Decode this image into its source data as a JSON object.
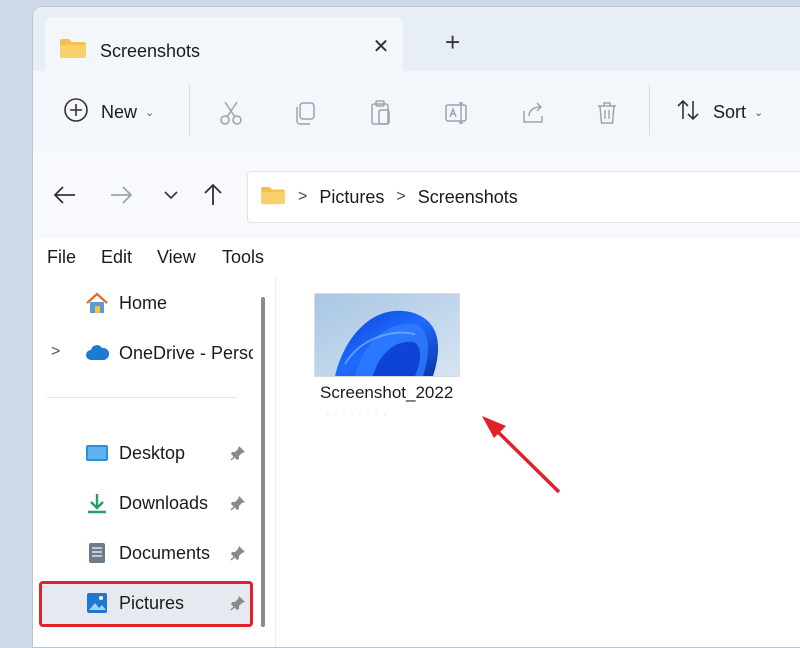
{
  "window": {
    "tab_title": "Screenshots",
    "close_symbol": "✕",
    "new_tab_symbol": "+"
  },
  "toolbar": {
    "new_label": "New",
    "sort_label": "Sort",
    "dropdown_symbol": "⌄",
    "icons": [
      "cut-icon",
      "copy-icon",
      "paste-icon",
      "rename-icon",
      "share-icon",
      "delete-icon"
    ]
  },
  "address": {
    "segments": [
      "Pictures",
      "Screenshots"
    ],
    "separator": ">"
  },
  "menu": {
    "items": [
      "File",
      "Edit",
      "View",
      "Tools"
    ]
  },
  "sidebar": {
    "expand_symbol": ">",
    "items": [
      {
        "label": "Home",
        "icon": "home-icon"
      },
      {
        "label": "OneDrive - Persc",
        "icon": "cloud-icon"
      },
      {
        "label": "Desktop",
        "icon": "desktop-icon"
      },
      {
        "label": "Downloads",
        "icon": "download-icon"
      },
      {
        "label": "Documents",
        "icon": "documents-icon"
      },
      {
        "label": "Pictures",
        "icon": "pictures-icon"
      }
    ]
  },
  "content": {
    "file_name": "Screenshot_2022",
    "file_subtext": "· · · · · · · ·"
  },
  "colors": {
    "accent": "#0067c0",
    "highlight_border": "#e0202a",
    "folder": "#f2c14e"
  }
}
